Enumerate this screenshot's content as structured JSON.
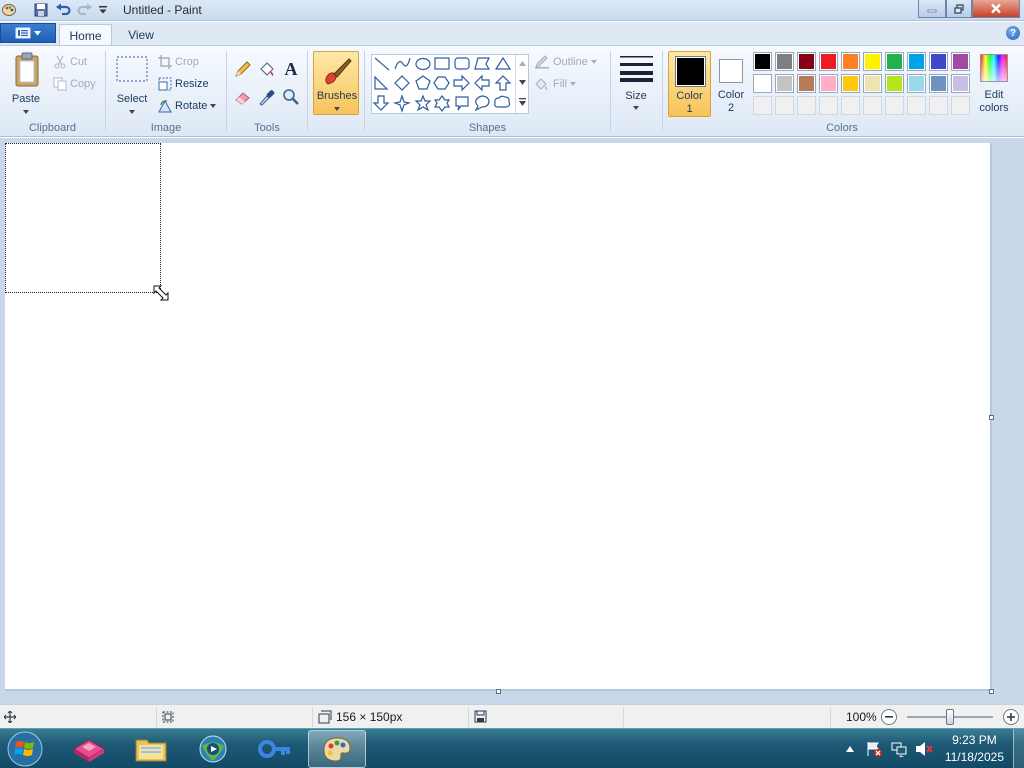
{
  "window": {
    "title": "Untitled - Paint",
    "minimize_label": "—",
    "maximize_label": "▢",
    "close_label": "✕"
  },
  "tabs": [
    {
      "label": "Home",
      "active": true
    },
    {
      "label": "View",
      "active": false
    }
  ],
  "help_label": "?",
  "ribbon": {
    "clipboard": {
      "paste_label": "Paste",
      "cut_label": "Cut",
      "copy_label": "Copy",
      "group_label": "Clipboard"
    },
    "image": {
      "select_label": "Select",
      "crop_label": "Crop",
      "resize_label": "Resize",
      "rotate_label": "Rotate",
      "group_label": "Image"
    },
    "tools": {
      "group_label": "Tools",
      "text_tool_glyph": "A"
    },
    "brushes": {
      "label": "Brushes"
    },
    "shapes": {
      "outline_label": "Outline",
      "fill_label": "Fill",
      "group_label": "Shapes"
    },
    "size": {
      "label": "Size"
    },
    "color1": {
      "label_line1": "Color",
      "label_line2": "1",
      "color": "#000000"
    },
    "color2": {
      "label_line1": "Color",
      "label_line2": "2",
      "color": "#ffffff"
    },
    "colors": {
      "group_label": "Colors",
      "row1": [
        "#000000",
        "#7f7f7f",
        "#880015",
        "#ed1c24",
        "#ff7f27",
        "#fff200",
        "#22b14c",
        "#00a2e8",
        "#3f48cc",
        "#a349a4"
      ],
      "row2": [
        "#ffffff",
        "#c3c3c3",
        "#b97a57",
        "#ffaec9",
        "#ffc90e",
        "#efe4b0",
        "#b5e61d",
        "#99d9ea",
        "#7092be",
        "#c8bfe7"
      ],
      "row3": [
        "#f0f0f0",
        "#f0f0f0",
        "#f0f0f0",
        "#f0f0f0",
        "#f0f0f0",
        "#f0f0f0",
        "#f0f0f0",
        "#f0f0f0",
        "#f0f0f0",
        "#f0f0f0"
      ]
    },
    "edit_colors": {
      "label_line1": "Edit",
      "label_line2": "colors"
    }
  },
  "status": {
    "selection_size": "156 × 150px",
    "zoom": "100%",
    "zoom_level": 0.5
  },
  "taskbar": {
    "time": "9:23 PM",
    "date": "11/18/2025"
  }
}
